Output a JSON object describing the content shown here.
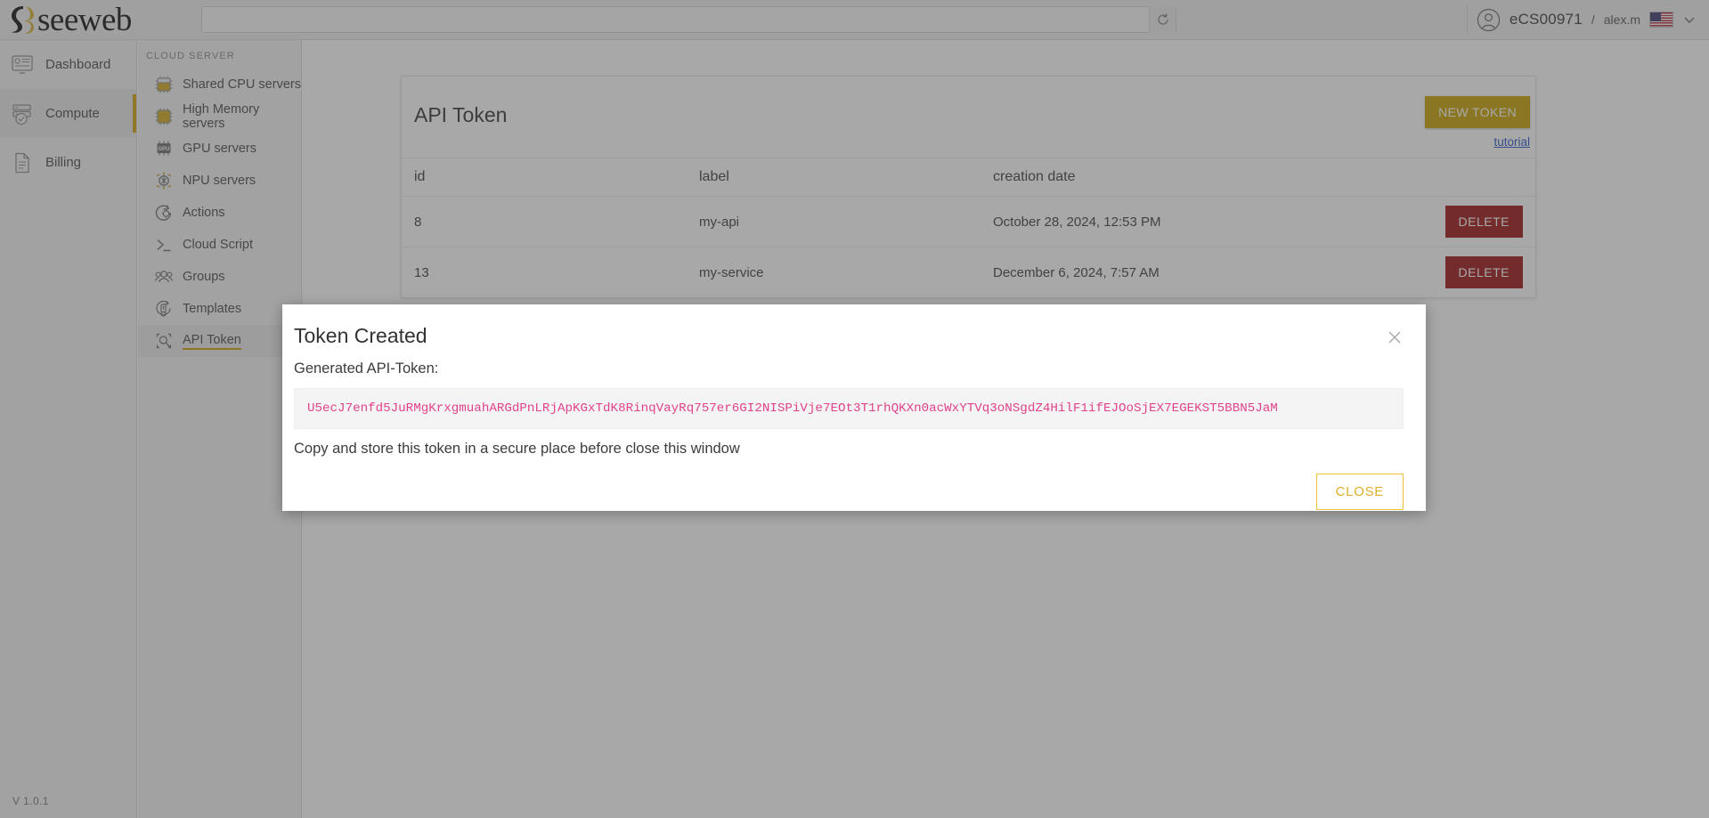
{
  "brand": {
    "name": "seeweb",
    "logo_icon": "seeweb-logo-icon"
  },
  "topbar": {
    "search": {
      "value": "",
      "placeholder": ""
    },
    "refresh_icon": "refresh-icon",
    "account_icon": "user-avatar-icon",
    "account_name": "eCS00971",
    "account_separator": "/",
    "account_user": "alex.m",
    "flag_icon": "us-flag-icon",
    "chevron_icon": "chevron-down-icon"
  },
  "nav_primary": {
    "items": [
      {
        "label": "Dashboard",
        "icon": "dashboard-icon",
        "active": false
      },
      {
        "label": "Compute",
        "icon": "server-stack-icon",
        "active": true
      },
      {
        "label": "Billing",
        "icon": "document-icon",
        "active": false
      }
    ],
    "version": "V 1.0.1"
  },
  "nav_secondary": {
    "heading": "CLOUD SERVER",
    "items": [
      {
        "label": "Shared CPU servers",
        "icon": "cpu-chip-icon",
        "active": false
      },
      {
        "label": "High Memory servers",
        "icon": "memory-chip-icon",
        "active": false
      },
      {
        "label": "GPU servers",
        "icon": "gpu-chip-icon",
        "active": false
      },
      {
        "label": "NPU servers",
        "icon": "npu-chip-icon",
        "active": false
      },
      {
        "label": "Actions",
        "icon": "actions-gear-icon",
        "active": false
      },
      {
        "label": "Cloud Script",
        "icon": "terminal-prompt-icon",
        "active": false
      },
      {
        "label": "Groups",
        "icon": "groups-people-icon",
        "active": false
      },
      {
        "label": "Templates",
        "icon": "templates-icon",
        "active": false
      },
      {
        "label": "API Token",
        "icon": "api-token-icon",
        "active": true
      }
    ]
  },
  "panel": {
    "title": "API Token",
    "new_token_label": "NEW TOKEN",
    "tutorial_label": "tutorial",
    "columns": [
      "id",
      "label",
      "creation date",
      ""
    ],
    "rows": [
      {
        "id": "8",
        "label": "my-api",
        "creation_date": "October 28, 2024, 12:53 PM",
        "action": "DELETE"
      },
      {
        "id": "13",
        "label": "my-service",
        "creation_date": "December 6, 2024, 7:57 AM",
        "action": "DELETE"
      }
    ]
  },
  "modal": {
    "title": "Token Created",
    "close_icon": "close-x-icon",
    "subtitle": "Generated API-Token:",
    "token": "U5ecJ7enfd5JuRMgKrxgmuahARGdPnLRjApKGxTdK8RinqVayRq757er6GI2NISPiVje7EOt3T1rhQKXn0acWxYTVq3oNSgdZ4HilF1ifEJOoSjEX7EGEKST5BBN5JaM",
    "note": "Copy and store this token in a secure place before close this window",
    "close_label": "CLOSE"
  },
  "colors": {
    "brand_yellow": "#c8a007",
    "accent_yellow": "#d5a20f",
    "danger_red": "#9e1414",
    "token_pink": "#e0438c",
    "link_blue": "#2a55c8"
  }
}
